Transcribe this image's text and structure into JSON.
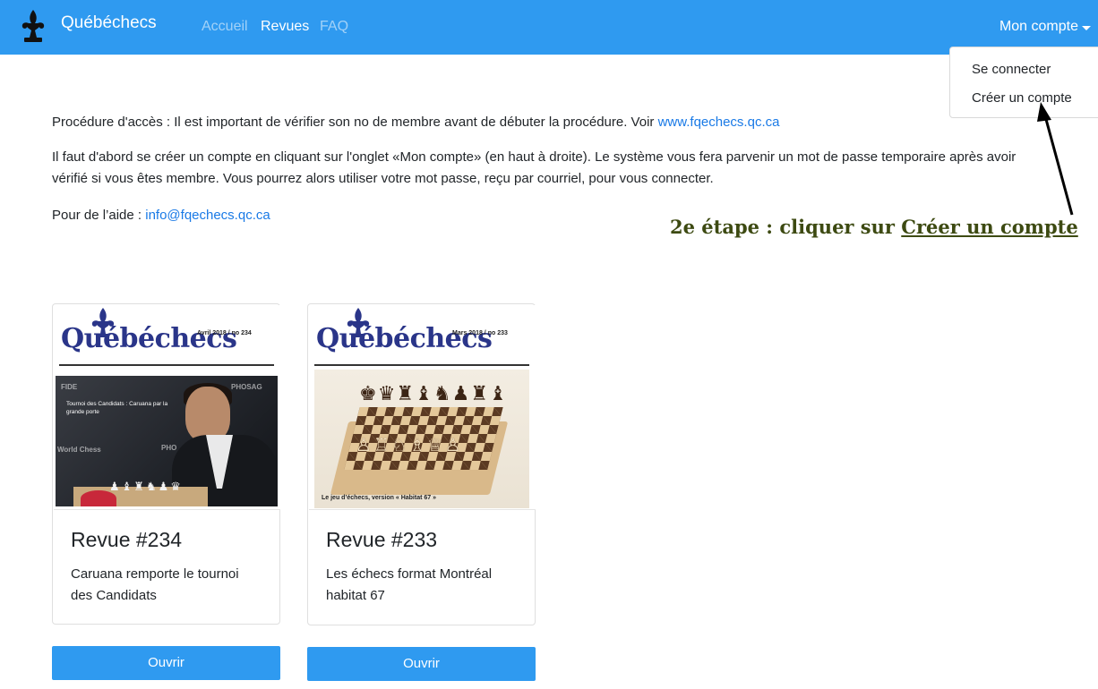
{
  "navbar": {
    "brand": "Québéchecs",
    "links": [
      {
        "label": "Accueil",
        "active": false
      },
      {
        "label": "Revues",
        "active": true
      },
      {
        "label": "FAQ",
        "active": false
      }
    ],
    "account_label": "Mon compte",
    "bg_color": "#2f9af0"
  },
  "dropdown": {
    "items": [
      "Se connecter",
      "Créer un compte"
    ]
  },
  "intro": {
    "p1_text": "Procédure d'accès : Il est important de vérifier son no de membre avant de débuter la procédure. Voir ",
    "p1_link": "www.fqechecs.qc.ca",
    "p2_text": "Il faut d'abord se créer un compte en cliquant sur l'onglet «Mon compte» (en haut à droite). Le système vous fera parvenir un mot de passe temporaire après avoir vérifié si vous êtes membre. Vous pourrez alors utiliser votre mot passe, reçu par courriel, pour vous connecter.",
    "p3_text": "Pour de l’aide : ",
    "p3_link": "info@fqechecs.qc.ca"
  },
  "annotation": {
    "prefix": "2e étape : cliquer sur ",
    "target": "Créer un compte",
    "color": "#3d4a12"
  },
  "revues": [
    {
      "cover_title": "Québéchecs",
      "cover_issue": "Avril 2018 / no 234",
      "cover_caption": "Tournoi des Candidats : Caruana par la grande porte",
      "cover_sponsors": [
        "FIDE",
        "PHOSAG",
        "World Chess",
        "PHO"
      ],
      "title": "Revue #234",
      "description": "Caruana remporte le tournoi des Candidats",
      "button": "Ouvrir"
    },
    {
      "cover_title": "Québéchecs",
      "cover_issue": "Mars 2018 / no 233",
      "cover_caption": "Le jeu d’échecs, version « Habitat 67 »",
      "title": "Revue #233",
      "description": "Les échecs format Montréal habitat 67",
      "button": "Ouvrir"
    }
  ]
}
